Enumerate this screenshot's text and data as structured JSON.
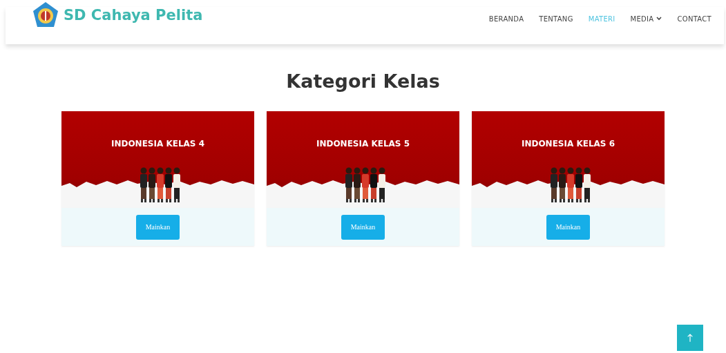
{
  "header": {
    "brand": "SD Cahaya Pelita"
  },
  "nav": [
    {
      "label": "BERANDA",
      "selected": false,
      "kind": "link"
    },
    {
      "label": "TENTANG",
      "selected": false,
      "kind": "link"
    },
    {
      "label": "MATERI",
      "selected": true,
      "kind": "link"
    },
    {
      "label": "MEDIA",
      "selected": false,
      "kind": "dropdown"
    },
    {
      "label": "CONTACT",
      "selected": false,
      "kind": "link"
    }
  ],
  "section": {
    "title": "Kategori Kelas"
  },
  "cards": [
    {
      "title": "INDONESIA KELAS 4",
      "button": "Mainkan"
    },
    {
      "title": "INDONESIA KELAS 5",
      "button": "Mainkan"
    },
    {
      "title": "INDONESIA KELAS 6",
      "button": "Mainkan"
    }
  ]
}
